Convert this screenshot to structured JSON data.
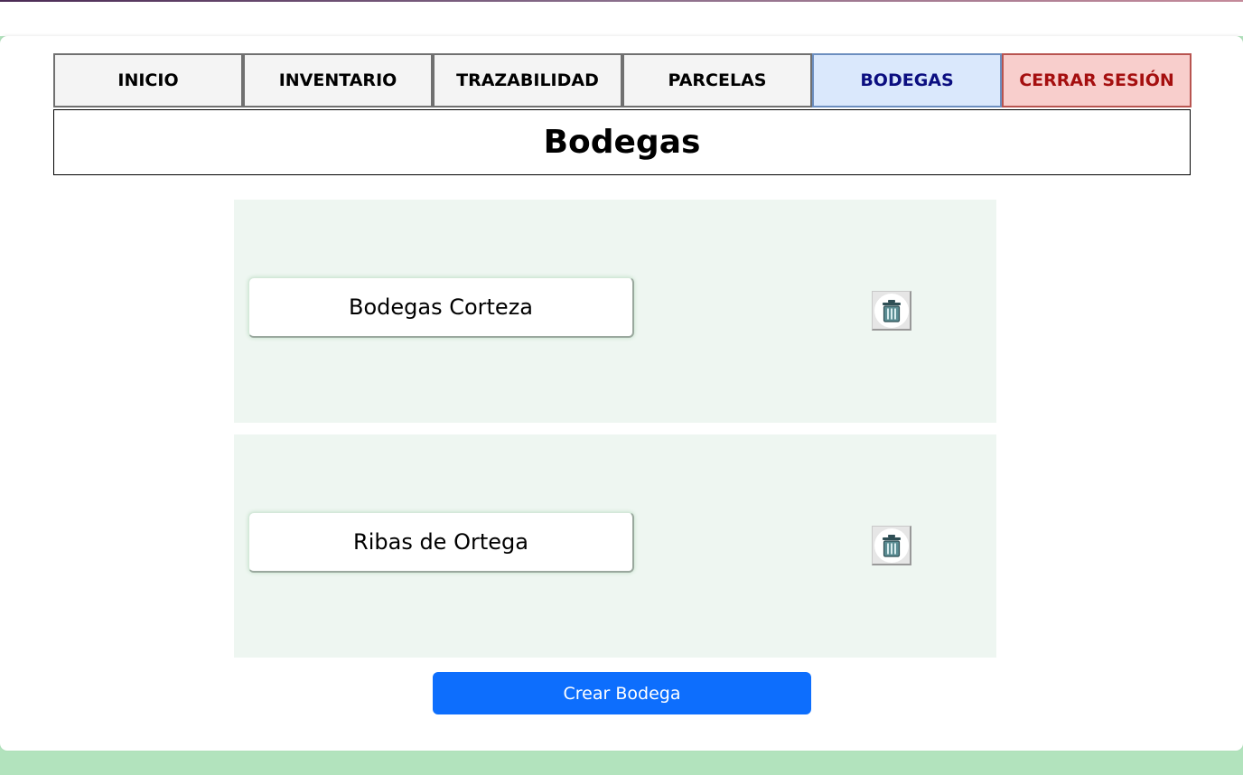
{
  "nav": {
    "items": [
      {
        "label": "INICIO"
      },
      {
        "label": "INVENTARIO"
      },
      {
        "label": "TRAZABILIDAD"
      },
      {
        "label": "PARCELAS"
      },
      {
        "label": "BODEGAS"
      },
      {
        "label": "CERRAR SESIÓN"
      }
    ],
    "active": "BODEGAS"
  },
  "page": {
    "title": "Bodegas"
  },
  "bodegas": [
    {
      "name": "Bodegas Corteza",
      "delete_icon": "trash-icon"
    },
    {
      "name": "Ribas de Ortega",
      "delete_icon": "trash-icon"
    }
  ],
  "actions": {
    "create_label": "Crear Bodega"
  },
  "colors": {
    "primary_button": "#0d6efd",
    "active_tab_bg": "#dae8fc",
    "logout_tab_bg": "#f8cecc",
    "row_bg": "#eef6f1",
    "page_bg": "#b2e3bd"
  }
}
